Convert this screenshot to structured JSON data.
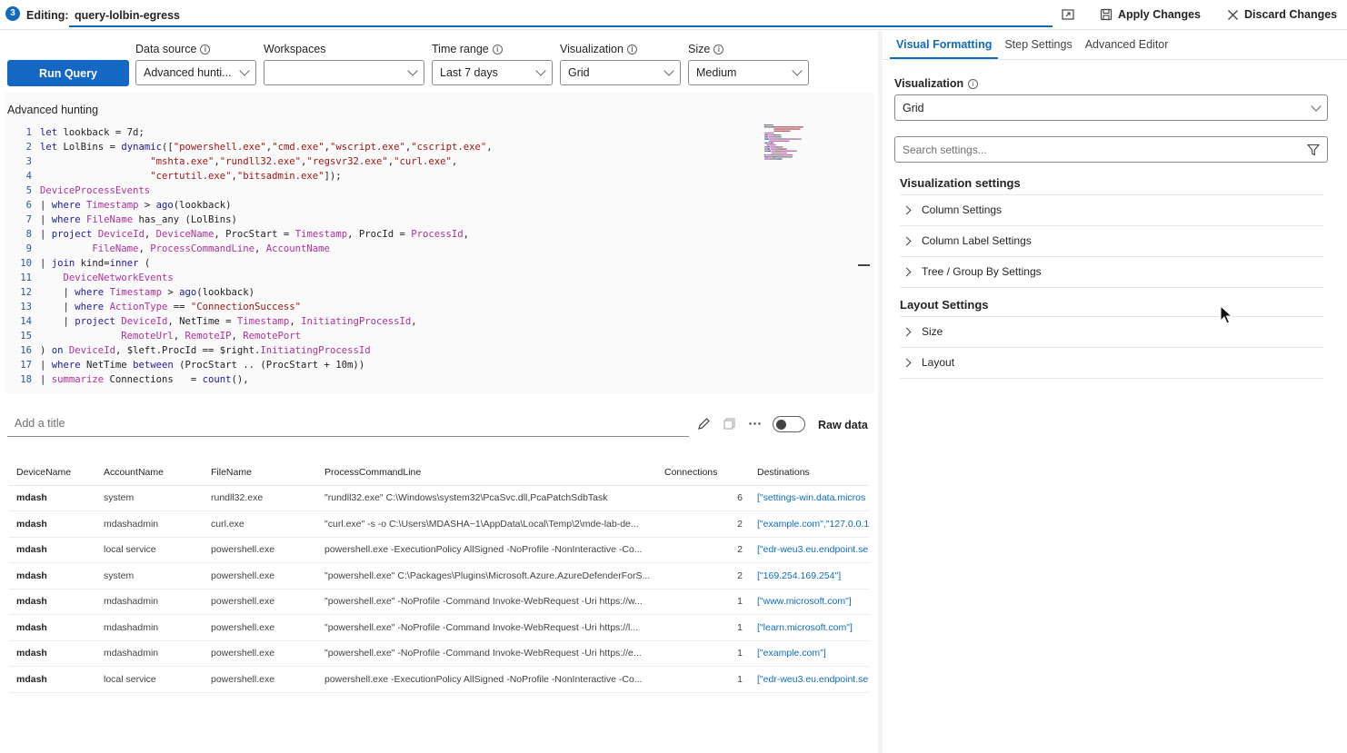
{
  "topbar": {
    "step_number": "3",
    "editing_label": "Editing:",
    "query_name": "query-lolbin-egress",
    "apply_label": "Apply Changes",
    "discard_label": "Discard Changes"
  },
  "toolbar": {
    "run_label": "Run Query",
    "data_source": {
      "label": "Data source",
      "value": "Advanced hunti..."
    },
    "workspaces": {
      "label": "Workspaces",
      "value": ""
    },
    "time_range": {
      "label": "Time range",
      "value": "Last 7 days"
    },
    "visualization": {
      "label": "Visualization",
      "value": "Grid"
    },
    "size": {
      "label": "Size",
      "value": "Medium"
    }
  },
  "editor": {
    "title": "Advanced hunting",
    "lines": [
      [
        [
          "kw",
          "let"
        ],
        [
          "pl",
          " lookback = 7d;"
        ]
      ],
      [
        [
          "kw",
          "let"
        ],
        [
          "pl",
          " LolBins = "
        ],
        [
          "fn",
          "dynamic"
        ],
        [
          "pl",
          "(["
        ],
        [
          "str",
          "\"powershell.exe\""
        ],
        [
          "pl",
          ","
        ],
        [
          "str",
          "\"cmd.exe\""
        ],
        [
          "pl",
          ","
        ],
        [
          "str",
          "\"wscript.exe\""
        ],
        [
          "pl",
          ","
        ],
        [
          "str",
          "\"cscript.exe\""
        ],
        [
          "pl",
          ","
        ]
      ],
      [
        [
          "pl",
          "                   "
        ],
        [
          "str",
          "\"mshta.exe\""
        ],
        [
          "pl",
          ","
        ],
        [
          "str",
          "\"rundll32.exe\""
        ],
        [
          "pl",
          ","
        ],
        [
          "str",
          "\"regsvr32.exe\""
        ],
        [
          "pl",
          ","
        ],
        [
          "str",
          "\"curl.exe\""
        ],
        [
          "pl",
          ","
        ]
      ],
      [
        [
          "pl",
          "                   "
        ],
        [
          "str",
          "\"certutil.exe\""
        ],
        [
          "pl",
          ","
        ],
        [
          "str",
          "\"bitsadmin.exe\""
        ],
        [
          "pl",
          "]);"
        ]
      ],
      [
        [
          "tb",
          "DeviceProcessEvents"
        ]
      ],
      [
        [
          "pl",
          "| "
        ],
        [
          "kw",
          "where"
        ],
        [
          "pl",
          " "
        ],
        [
          "tb",
          "Timestamp"
        ],
        [
          "pl",
          " > "
        ],
        [
          "fn",
          "ago"
        ],
        [
          "pl",
          "(lookback)"
        ]
      ],
      [
        [
          "pl",
          "| "
        ],
        [
          "kw",
          "where"
        ],
        [
          "pl",
          " "
        ],
        [
          "tb",
          "FileName"
        ],
        [
          "pl",
          " has_any (LolBins)"
        ]
      ],
      [
        [
          "pl",
          "| "
        ],
        [
          "kw",
          "project"
        ],
        [
          "pl",
          " "
        ],
        [
          "tb",
          "DeviceId"
        ],
        [
          "pl",
          ", "
        ],
        [
          "tb",
          "DeviceName"
        ],
        [
          "pl",
          ", ProcStart = "
        ],
        [
          "tb",
          "Timestamp"
        ],
        [
          "pl",
          ", ProcId = "
        ],
        [
          "tb",
          "ProcessId"
        ],
        [
          "pl",
          ","
        ]
      ],
      [
        [
          "pl",
          "         "
        ],
        [
          "tb",
          "FileName"
        ],
        [
          "pl",
          ", "
        ],
        [
          "tb",
          "ProcessCommandLine"
        ],
        [
          "pl",
          ", "
        ],
        [
          "tb",
          "AccountName"
        ]
      ],
      [
        [
          "pl",
          "| "
        ],
        [
          "kw",
          "join"
        ],
        [
          "pl",
          " kind="
        ],
        [
          "kw",
          "inner"
        ],
        [
          "pl",
          " ("
        ]
      ],
      [
        [
          "pl",
          "    "
        ],
        [
          "tb",
          "DeviceNetworkEvents"
        ]
      ],
      [
        [
          "pl",
          "    | "
        ],
        [
          "kw",
          "where"
        ],
        [
          "pl",
          " "
        ],
        [
          "tb",
          "Timestamp"
        ],
        [
          "pl",
          " > "
        ],
        [
          "fn",
          "ago"
        ],
        [
          "pl",
          "(lookback)"
        ]
      ],
      [
        [
          "pl",
          "    | "
        ],
        [
          "kw",
          "where"
        ],
        [
          "pl",
          " "
        ],
        [
          "tb",
          "ActionType"
        ],
        [
          "pl",
          " == "
        ],
        [
          "str",
          "\"ConnectionSuccess\""
        ]
      ],
      [
        [
          "pl",
          "    | "
        ],
        [
          "kw",
          "project"
        ],
        [
          "pl",
          " "
        ],
        [
          "tb",
          "DeviceId"
        ],
        [
          "pl",
          ", NetTime = "
        ],
        [
          "tb",
          "Timestamp"
        ],
        [
          "pl",
          ", "
        ],
        [
          "tb",
          "InitiatingProcessId"
        ],
        [
          "pl",
          ","
        ]
      ],
      [
        [
          "pl",
          "              "
        ],
        [
          "tb",
          "RemoteUrl"
        ],
        [
          "pl",
          ", "
        ],
        [
          "tb",
          "RemoteIP"
        ],
        [
          "pl",
          ", "
        ],
        [
          "tb",
          "RemotePort"
        ]
      ],
      [
        [
          "pl",
          ") "
        ],
        [
          "kw",
          "on"
        ],
        [
          "pl",
          " "
        ],
        [
          "tb",
          "DeviceId"
        ],
        [
          "pl",
          ", $left.ProcId == $right."
        ],
        [
          "tb",
          "InitiatingProcessId"
        ]
      ],
      [
        [
          "pl",
          "| "
        ],
        [
          "kw",
          "where"
        ],
        [
          "pl",
          " NetTime "
        ],
        [
          "kw",
          "between"
        ],
        [
          "pl",
          " (ProcStart .. (ProcStart + 10m))"
        ]
      ],
      [
        [
          "pl",
          "| "
        ],
        [
          "tb",
          "summarize"
        ],
        [
          "pl",
          " Connections   = "
        ],
        [
          "fn",
          "count"
        ],
        [
          "pl",
          "(),"
        ]
      ]
    ]
  },
  "results": {
    "title_placeholder": "Add a title",
    "raw_data_label": "Raw data",
    "columns": [
      "DeviceName",
      "AccountName",
      "FileName",
      "ProcessCommandLine",
      "Connections",
      "Destinations"
    ],
    "rows": [
      [
        "mdash",
        "system",
        "rundll32.exe",
        "\"rundll32.exe\" C:\\Windows\\system32\\PcaSvc.dll,PcaPatchSdbTask",
        "6",
        "[\"settings-win.data.micros"
      ],
      [
        "mdash",
        "mdashadmin",
        "curl.exe",
        "\"curl.exe\" -s -o C:\\Users\\MDASHA~1\\AppData\\Local\\Temp\\2\\mde-lab-de...",
        "2",
        "[\"example.com\",\"127.0.0.1"
      ],
      [
        "mdash",
        "local service",
        "powershell.exe",
        "powershell.exe -ExecutionPolicy AllSigned -NoProfile -NonInteractive -Co...",
        "2",
        "[\"edr-weu3.eu.endpoint.se"
      ],
      [
        "mdash",
        "system",
        "powershell.exe",
        "\"powershell.exe\" C:\\Packages\\Plugins\\Microsoft.Azure.AzureDefenderForS...",
        "2",
        "[\"169.254.169.254\"]"
      ],
      [
        "mdash",
        "mdashadmin",
        "powershell.exe",
        "\"powershell.exe\" -NoProfile -Command Invoke-WebRequest -Uri https://w...",
        "1",
        "[\"www.microsoft.com\"]"
      ],
      [
        "mdash",
        "mdashadmin",
        "powershell.exe",
        "\"powershell.exe\" -NoProfile -Command Invoke-WebRequest -Uri https://l...",
        "1",
        "[\"learn.microsoft.com\"]"
      ],
      [
        "mdash",
        "mdashadmin",
        "powershell.exe",
        "\"powershell.exe\" -NoProfile -Command Invoke-WebRequest -Uri https://e...",
        "1",
        "[\"example.com\"]"
      ],
      [
        "mdash",
        "local service",
        "powershell.exe",
        "powershell.exe -ExecutionPolicy AllSigned -NoProfile -NonInteractive -Co...",
        "1",
        "[\"edr-weu3.eu.endpoint.se"
      ]
    ]
  },
  "right_panel": {
    "tabs": [
      "Visual Formatting",
      "Step Settings",
      "Advanced Editor"
    ],
    "active_tab": 0,
    "visualization_label": "Visualization",
    "visualization_value": "Grid",
    "search_placeholder": "Search settings...",
    "vis_settings_header": "Visualization settings",
    "vis_settings_items": [
      "Column Settings",
      "Column Label Settings",
      "Tree / Group By Settings"
    ],
    "layout_header": "Layout Settings",
    "layout_items": [
      "Size",
      "Layout"
    ]
  },
  "colors": {
    "accent": "#0f6cbd",
    "run_button": "#1567c4",
    "keyword": "#1a1aa6",
    "table": "#b02f9a",
    "string": "#a31515"
  }
}
